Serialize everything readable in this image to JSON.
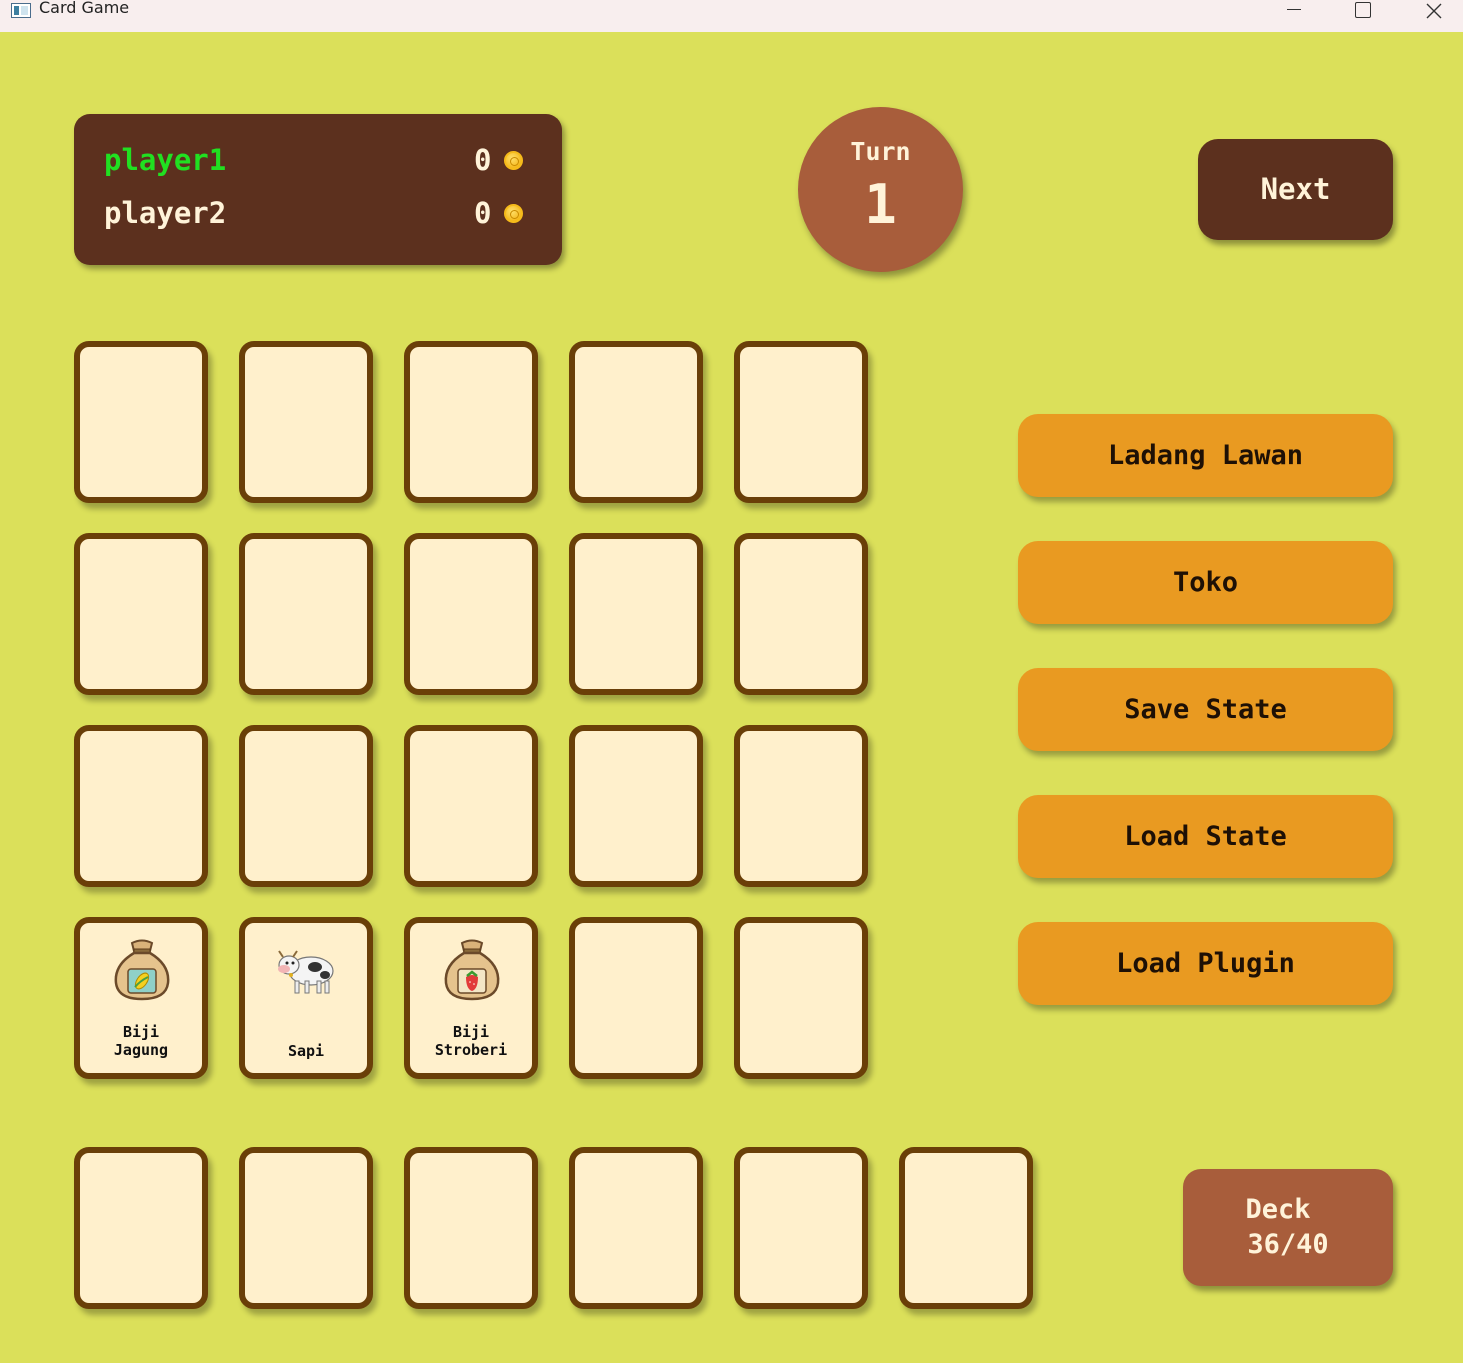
{
  "window": {
    "title": "Card Game",
    "controls": [
      "minimize-icon",
      "maximize-icon",
      "close-icon"
    ]
  },
  "scoreboard": {
    "players": [
      {
        "name": "player1",
        "coins": "0",
        "active": true
      },
      {
        "name": "player2",
        "coins": "0",
        "active": false
      }
    ],
    "coin_icon": "coin-icon"
  },
  "turn": {
    "label": "Turn",
    "number": "1"
  },
  "next_button": {
    "label": "Next"
  },
  "field": {
    "rows": 4,
    "cols": 5,
    "cards": [
      {
        "slot": 15,
        "name": "Biji\nJagung",
        "line1": "Biji",
        "line2": "Jagung",
        "icon": "corn-seed-bag-icon"
      },
      {
        "slot": 16,
        "name": "Sapi",
        "line1": "Sapi",
        "line2": "",
        "icon": "cow-icon"
      },
      {
        "slot": 17,
        "name": "Biji\nStroberi",
        "line1": "Biji",
        "line2": "Stroberi",
        "icon": "strawberry-seed-bag-icon"
      }
    ]
  },
  "hand": {
    "slots": 6
  },
  "actions": {
    "ladang_lawan": "Ladang Lawan",
    "toko": "Toko",
    "save_state": "Save State",
    "load_state": "Load State",
    "load_plugin": "Load Plugin"
  },
  "deck": {
    "label": "Deck",
    "count": "36/40"
  },
  "colors": {
    "background": "#dbe05a",
    "dark_brown": "#5c301e",
    "rust": "#a85d3b",
    "orange": "#e99a21",
    "card_fill": "#fff0cc",
    "card_border": "#6a3f08",
    "active_player": "#21e021"
  }
}
